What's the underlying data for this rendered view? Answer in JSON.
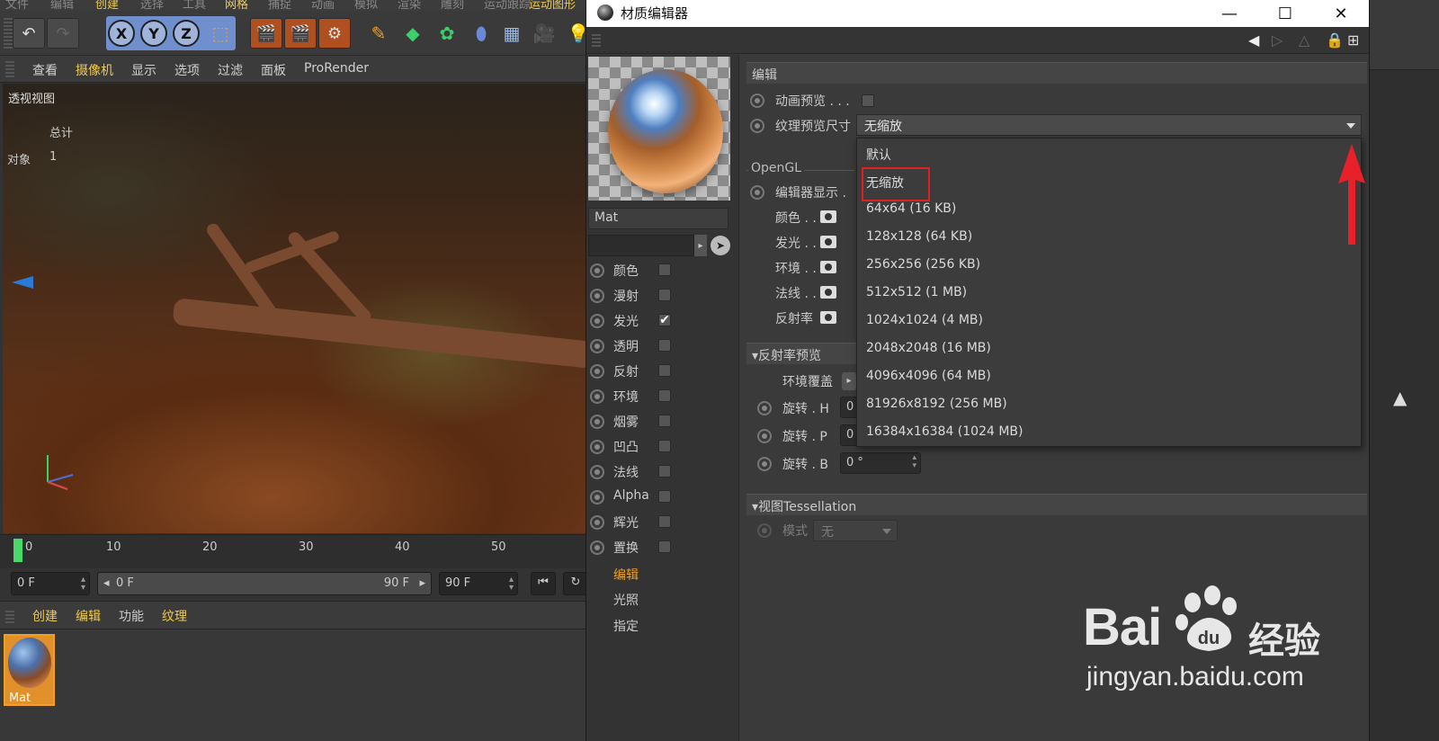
{
  "c4d": {
    "top_menu": [
      "文件",
      "编辑",
      "创建",
      "选择",
      "工具",
      "网格",
      "捕捉",
      "动画",
      "模拟",
      "渲染",
      "雕刻",
      "运动跟踪",
      "运动图形"
    ],
    "axis_buttons": [
      "X",
      "Y",
      "Z"
    ],
    "view_menu": [
      "查看",
      "摄像机",
      "显示",
      "选项",
      "过滤",
      "面板",
      "ProRender"
    ],
    "viewport": {
      "label": "透视视图",
      "total_label": "总计",
      "objects_label": "对象",
      "objects_count": "1"
    },
    "timeline": {
      "ticks": [
        "0",
        "10",
        "20",
        "30",
        "40",
        "50"
      ]
    },
    "transport": {
      "start_field": "0 F",
      "range_start": "0 F",
      "range_end": "90 F",
      "end_field": "90 F"
    },
    "mat_menu": [
      "创建",
      "编辑",
      "功能",
      "纹理"
    ],
    "material_thumb_label": "Mat"
  },
  "material_editor": {
    "title": "材质编辑器",
    "window_buttons": [
      "—",
      "☐",
      "✕"
    ],
    "material_name": "Mat",
    "channels": [
      {
        "label": "颜色",
        "checked": false
      },
      {
        "label": "漫射",
        "checked": false
      },
      {
        "label": "发光",
        "checked": true
      },
      {
        "label": "透明",
        "checked": false
      },
      {
        "label": "反射",
        "checked": false
      },
      {
        "label": "环境",
        "checked": false
      },
      {
        "label": "烟雾",
        "checked": false
      },
      {
        "label": "凹凸",
        "checked": false
      },
      {
        "label": "法线",
        "checked": false
      },
      {
        "label": "Alpha",
        "checked": false
      },
      {
        "label": "辉光",
        "checked": false
      },
      {
        "label": "置换",
        "checked": false
      }
    ],
    "links": [
      {
        "label": "编辑",
        "active": true
      },
      {
        "label": "光照",
        "active": false
      },
      {
        "label": "指定",
        "active": false
      }
    ],
    "section_edit": "编辑",
    "anim_preview_label": "动画预览 . . .",
    "tex_preview_label": "纹理预览尺寸",
    "tex_preview_value": "无缩放",
    "opengl_label": "OpenGL",
    "editor_display_label": "编辑器显示 .",
    "display_items": [
      "颜色 . .",
      "发光 . .",
      "环境 . .",
      "法线 . .",
      "反射率"
    ],
    "reflectance_section": "▾反射率预览",
    "env_override_label": "环境覆盖",
    "rotations": [
      {
        "label": "旋转 . H",
        "value": "0"
      },
      {
        "label": "旋转 . P",
        "value": "0"
      },
      {
        "label": "旋转 . B",
        "value": "0 °"
      }
    ],
    "tessellation_section": "▾视图Tessellation",
    "mode_label": "模式",
    "mode_value": "无",
    "dropdown_options": [
      "默认",
      "无缩放",
      "64x64 (16 KB)",
      "128x128 (64 KB)",
      "256x256 (256 KB)",
      "512x512 (1 MB)",
      "1024x1024 (4 MB)",
      "2048x2048 (16 MB)",
      "4096x4096 (64 MB)",
      "81926x8192 (256 MB)",
      "16384x16384 (1024 MB)"
    ],
    "dropdown_highlighted": "无缩放"
  },
  "watermark": {
    "brand": "Bai",
    "paw_text": "du",
    "product": "经验",
    "url": "jingyan.baidu.com"
  },
  "colors": {
    "accent_yellow": "#f0c94a",
    "highlight_red": "#e02020",
    "playhead_green": "#4bd86a",
    "active_link": "#f0a020"
  },
  "icons": [
    "undo-icon",
    "redo-icon",
    "x-axis-icon",
    "y-axis-icon",
    "z-axis-icon",
    "coord-system-icon",
    "render-view-icon",
    "render-picture-queue-icon",
    "render-settings-icon",
    "pen-icon",
    "cube-icon",
    "nurbs-icon",
    "deformer-icon",
    "floor-icon",
    "camera-icon",
    "light-icon",
    "lock-icon",
    "new-window-icon",
    "pick-material-icon",
    "eye-icon",
    "red-up-arrow-icon"
  ]
}
